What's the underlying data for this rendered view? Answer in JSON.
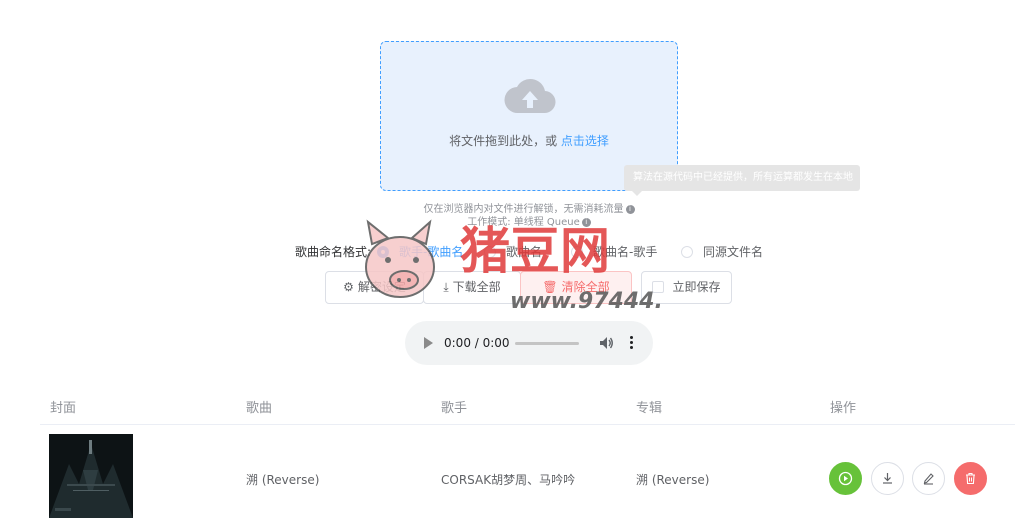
{
  "upload": {
    "drop_text": "将文件拖到此处，或 ",
    "drop_link": "点击选择",
    "tooltip": "算法在源代码中已经提供，所有运算都发生在本地",
    "hint_line1": "仅在浏览器内对文件进行解锁，无需消耗流量",
    "hint_line2": "工作模式: 单线程 Queue",
    "icon": "upload-cloud-icon"
  },
  "naming": {
    "label": "歌曲命名格式:",
    "options": [
      "歌手-歌曲名",
      "歌曲名",
      "歌曲名-歌手",
      "同源文件名"
    ],
    "selected": "歌手-歌曲名"
  },
  "actions": {
    "decrypt_settings": "解密设定",
    "download_all": "下载全部",
    "clear_all": "清除全部",
    "save_now": "立即保存"
  },
  "audio": {
    "time": "0:00 / 0:00"
  },
  "table": {
    "headers": [
      "封面",
      "歌曲",
      "歌手",
      "专辑",
      "操作"
    ],
    "rows": [
      {
        "song": "溯 (Reverse)",
        "artist": "CORSAK胡梦周、马吟吟",
        "album": "溯 (Reverse)"
      }
    ]
  },
  "watermark": {
    "title": "猪豆网",
    "url": "www.97444.cn"
  },
  "colors": {
    "primary": "#409eff",
    "success": "#67c23a",
    "danger": "#f56c6c",
    "watermark_red": "#e03a3a",
    "watermark_gray": "#555555"
  }
}
